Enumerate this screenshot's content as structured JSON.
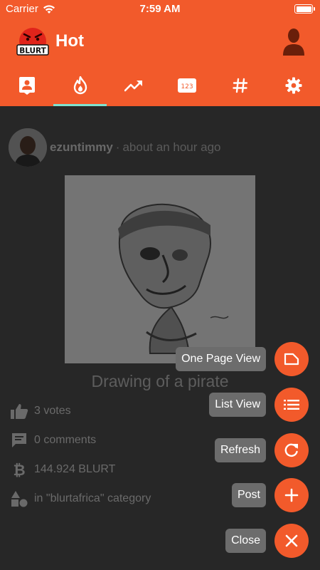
{
  "status_bar": {
    "carrier": "Carrier",
    "time": "7:59 AM"
  },
  "app_bar": {
    "title": "Hot",
    "logo_text": "BLURT"
  },
  "tabs": [
    {
      "name": "feed",
      "icon": "person-card-icon",
      "active": false
    },
    {
      "name": "hot",
      "icon": "fire-icon",
      "active": true
    },
    {
      "name": "trending",
      "icon": "trending-up-icon",
      "active": false
    },
    {
      "name": "new",
      "icon": "numbers-123-icon",
      "active": false
    },
    {
      "name": "tags",
      "icon": "hashtag-icon",
      "active": false
    },
    {
      "name": "settings",
      "icon": "gear-icon",
      "active": false
    }
  ],
  "post": {
    "author": "ezuntimmy",
    "separator": "·",
    "time_ago": "about an hour ago",
    "title": "Drawing of a pirate",
    "votes": "3 votes",
    "comments": "0 comments",
    "payout": "144.924 BLURT",
    "category": "in \"blurtafrica\" category"
  },
  "speed_dial": [
    {
      "label": "One Page View",
      "icon": "page-icon"
    },
    {
      "label": "List View",
      "icon": "list-icon"
    },
    {
      "label": "Refresh",
      "icon": "refresh-icon"
    },
    {
      "label": "Post",
      "icon": "plus-icon"
    },
    {
      "label": "Close",
      "icon": "close-icon"
    }
  ],
  "colors": {
    "accent": "#f25a2b",
    "tab_indicator": "#7fe3d0",
    "background": "#2b2b2b"
  }
}
